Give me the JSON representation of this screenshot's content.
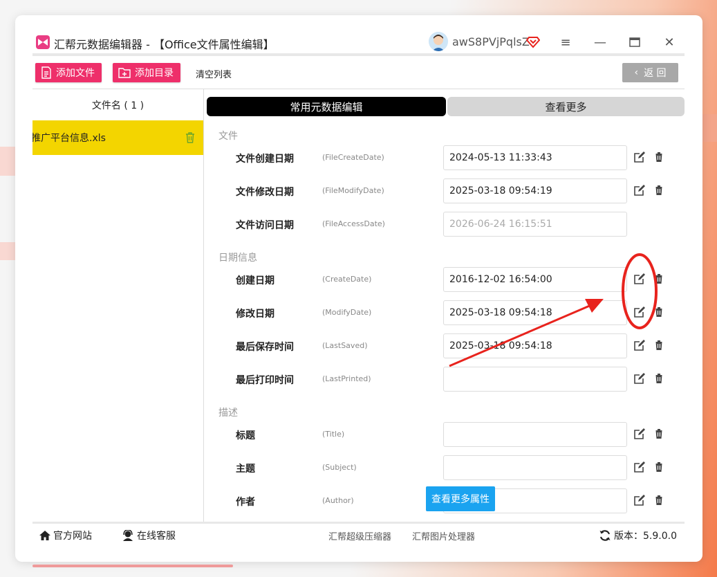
{
  "window": {
    "title": "汇帮元数据编辑器 - 【Office文件属性编辑】",
    "username": "awS8PVjPqlsZ"
  },
  "toolbar": {
    "add_file": "添加文件",
    "add_dir": "添加目录",
    "clear_list": "清空列表",
    "back": "返 回"
  },
  "left": {
    "header": "文件名 ( 1 )",
    "files": [
      "推广平台信息.xls"
    ]
  },
  "tabs": {
    "common": "常用元数据编辑",
    "more": "查看更多"
  },
  "sections": {
    "file": "文件",
    "date": "日期信息",
    "desc": "描述"
  },
  "rows": [
    {
      "label": "文件创建日期",
      "key": "(FileCreateDate)",
      "value": "2024-05-13 11:33:43"
    },
    {
      "label": "文件修改日期",
      "key": "(FileModifyDate)",
      "value": "2025-03-18 09:54:19"
    },
    {
      "label": "文件访问日期",
      "key": "(FileAccessDate)",
      "value": "2026-06-24 16:15:51"
    },
    {
      "label": "创建日期",
      "key": "(CreateDate)",
      "value": "2016-12-02 16:54:00"
    },
    {
      "label": "修改日期",
      "key": "(ModifyDate)",
      "value": "2025-03-18 09:54:18"
    },
    {
      "label": "最后保存时间",
      "key": "(LastSaved)",
      "value": "2025-03-18 09:54:18"
    },
    {
      "label": "最后打印时间",
      "key": "(LastPrinted)",
      "value": ""
    },
    {
      "label": "标题",
      "key": "(Title)",
      "value": ""
    },
    {
      "label": "主题",
      "key": "(Subject)",
      "value": ""
    },
    {
      "label": "作者",
      "key": "(Author)",
      "value": ""
    }
  ],
  "more_attr": "查看更多属性",
  "footer": {
    "website": "官方网站",
    "service": "在线客服",
    "compressor": "汇帮超级压缩器",
    "image_tool": "汇帮图片处理器",
    "version": "版本：5.9.0.0"
  },
  "colors": {
    "accent": "#ee2f6a",
    "selected_file": "#f3d500",
    "info_button": "#1aa3f0",
    "annotation": "#e8231d"
  }
}
